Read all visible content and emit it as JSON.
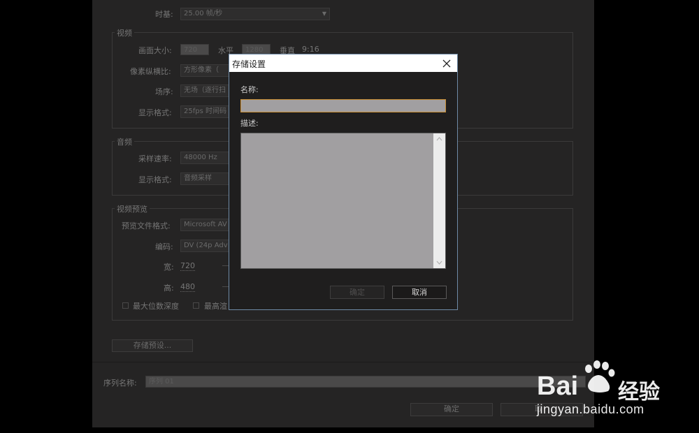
{
  "background_dialog": {
    "timebase": {
      "label": "时基:",
      "value": "25.00 帧/秒"
    },
    "video": {
      "legend": "视频",
      "frame_size": {
        "label": "画面大小:",
        "width": "720",
        "horizontal_label": "水平",
        "height": "1280",
        "vertical_label": "垂直",
        "aspect": "9:16"
      },
      "pixel_aspect": {
        "label": "像素纵横比:",
        "value": "方形像素（"
      },
      "fields": {
        "label": "场序:",
        "value": "无场（逐行扫"
      },
      "display_format": {
        "label": "显示格式:",
        "value": "25fps 时间码"
      }
    },
    "audio": {
      "legend": "音频",
      "sample_rate": {
        "label": "采样速率:",
        "value": "48000 Hz"
      },
      "display_format": {
        "label": "显示格式:",
        "value": "音频采样"
      }
    },
    "video_preview": {
      "legend": "视频预览",
      "file_format": {
        "label": "预览文件格式:",
        "value": "Microsoft AV"
      },
      "codec": {
        "label": "编码:",
        "value": "DV (24p Adv"
      },
      "width": {
        "label": "宽:",
        "value": "720"
      },
      "height": {
        "label": "高:",
        "value": "480"
      },
      "max_bit_depth": "最大位数深度",
      "max_quality": "最高渲"
    },
    "save_preset_button": "存储预设...",
    "sequence_name": {
      "label": "序列名称:",
      "value": "序列 01"
    },
    "ok_button": "确定",
    "cancel_partial": "取"
  },
  "modal": {
    "title": "存储设置",
    "name_label": "名称:",
    "name_value": "",
    "description_label": "描述:",
    "description_value": "",
    "ok_button": "确定",
    "cancel_button": "取消"
  },
  "watermark": {
    "brand": "Bai",
    "brand_suffix": "经验",
    "url": "jingyan.baidu.com"
  },
  "colors": {
    "modal_border": "#6e8aa6",
    "name_focus_border": "#c98f36",
    "field_gray": "#a19fa1"
  }
}
